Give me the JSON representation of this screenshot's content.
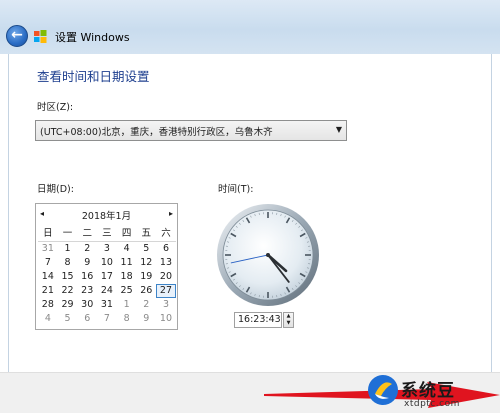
{
  "window": {
    "title": "设置 Windows",
    "back_icon": "back-arrow-icon",
    "app_icon": "windows-logo-icon"
  },
  "heading": "查看时间和日期设置",
  "timezone": {
    "label": "时区(Z):",
    "value": "(UTC+08:00)北京，重庆，香港特别行政区，乌鲁木齐"
  },
  "date": {
    "label": "日期(D):",
    "month_title": "2018年1月",
    "prev": "◂",
    "next": "▸",
    "weekdays": [
      "日",
      "一",
      "二",
      "三",
      "四",
      "五",
      "六"
    ],
    "weeks": [
      [
        "31",
        "1",
        "2",
        "3",
        "4",
        "5",
        "6"
      ],
      [
        "7",
        "8",
        "9",
        "10",
        "11",
        "12",
        "13"
      ],
      [
        "14",
        "15",
        "16",
        "17",
        "18",
        "19",
        "20"
      ],
      [
        "21",
        "22",
        "23",
        "24",
        "25",
        "26",
        "27"
      ],
      [
        "28",
        "29",
        "30",
        "31",
        "1",
        "2",
        "3"
      ],
      [
        "4",
        "5",
        "6",
        "7",
        "8",
        "9",
        "10"
      ]
    ],
    "selected_day": "27"
  },
  "time": {
    "label": "时间(T):",
    "value": "16:23:43",
    "hour": 16,
    "minute": 23,
    "second": 43
  },
  "watermark": {
    "name": "系统豆",
    "url": "xtdptc.com"
  },
  "colors": {
    "heading": "#1e3f8f",
    "selection": "#3d84c8",
    "arrow": "#e0141f"
  }
}
